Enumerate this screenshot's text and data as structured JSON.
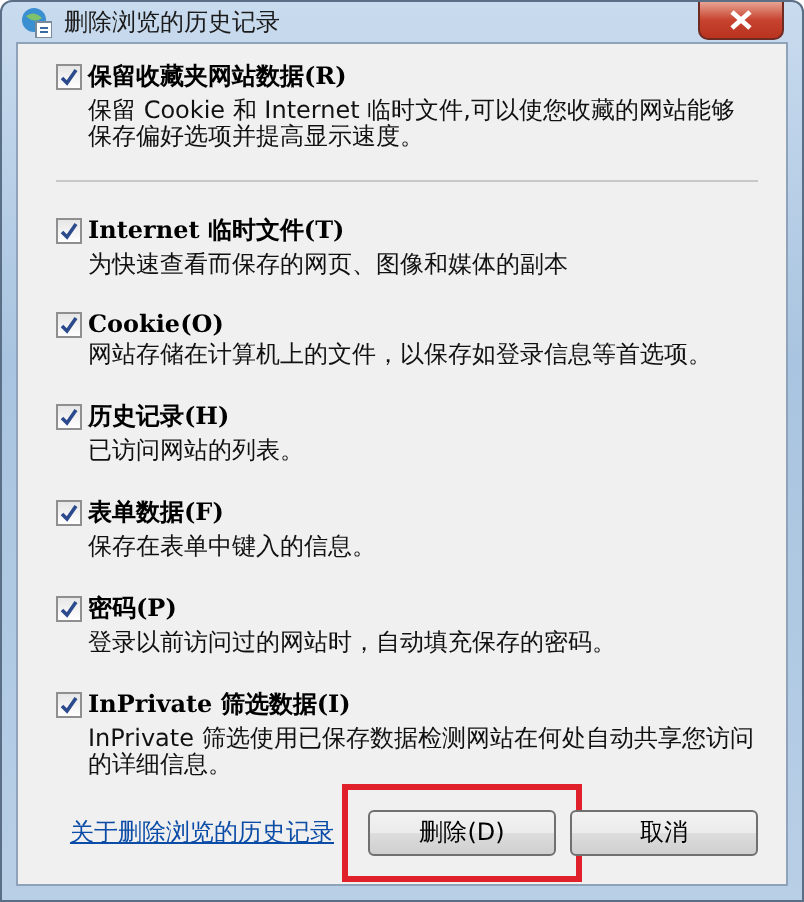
{
  "window": {
    "title": "删除浏览的历史记录"
  },
  "options": [
    {
      "label": "保留收藏夹网站数据(R)",
      "checked": true,
      "description": "保留 Cookie 和 Internet 临时文件,可以使您收藏的网站能够保存偏好选项并提高显示速度。",
      "divider_after": true
    },
    {
      "label": "Internet 临时文件(T)",
      "checked": true,
      "description": "为快速查看而保存的网页、图像和媒体的副本",
      "divider_after": false
    },
    {
      "label": "Cookie(O)",
      "checked": true,
      "description": "网站存储在计算机上的文件，以保存如登录信息等首选项。",
      "divider_after": false
    },
    {
      "label": "历史记录(H)",
      "checked": true,
      "description": "已访问网站的列表。",
      "divider_after": false
    },
    {
      "label": "表单数据(F)",
      "checked": true,
      "description": "保存在表单中键入的信息。",
      "divider_after": false
    },
    {
      "label": "密码(P)",
      "checked": true,
      "description": "登录以前访问过的网站时，自动填充保存的密码。",
      "divider_after": false
    },
    {
      "label": "InPrivate 筛选数据(I)",
      "checked": true,
      "description": "InPrivate 筛选使用已保存数据检测网站在何处自动共享您访问的详细信息。",
      "divider_after": false
    }
  ],
  "help_link": "关于删除浏览的历史记录",
  "buttons": [
    {
      "label": "删除(D)",
      "highlighted": true
    },
    {
      "label": "取消",
      "highlighted": false
    }
  ]
}
